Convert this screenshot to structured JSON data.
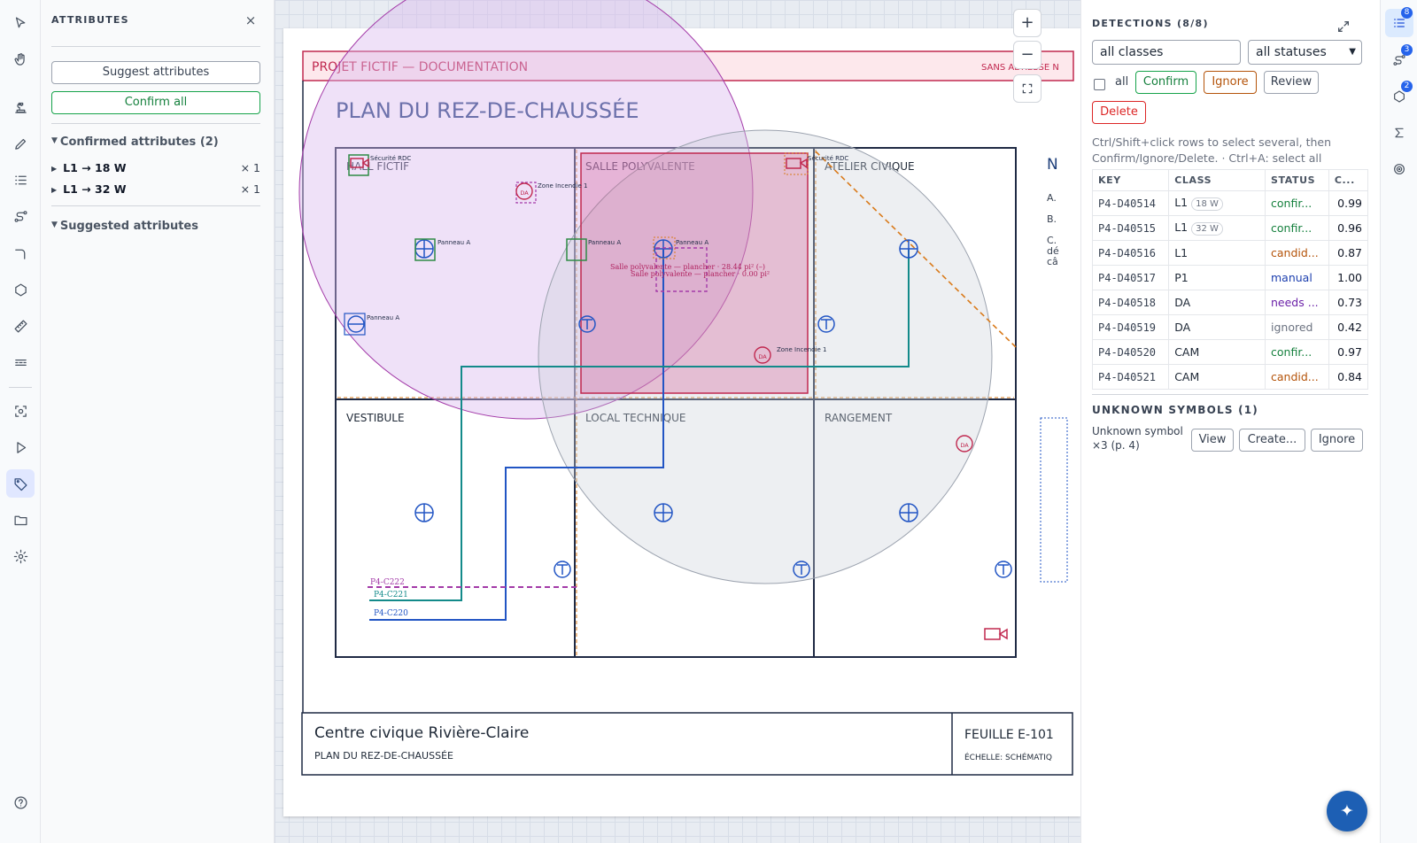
{
  "left_rail": {
    "icons": [
      "pointer-icon",
      "hand-icon",
      "stamp-icon",
      "pencil-icon",
      "list-icon",
      "path-icon",
      "bend-icon",
      "hexagon-icon",
      "ruler-icon",
      "dashes-icon",
      "scan-icon",
      "play-icon",
      "tag-icon",
      "folder-icon",
      "gear-icon",
      "help-icon"
    ],
    "active": "tag-icon"
  },
  "attributes": {
    "title": "ATTRIBUTES",
    "close": "×",
    "suggest_label": "Suggest attributes",
    "confirm_all_label": "Confirm all",
    "confirmed_heading": "Confirmed attributes (2)",
    "confirmed": [
      {
        "label": "L1 → 18 W",
        "count": "× 1"
      },
      {
        "label": "L1 → 32 W",
        "count": "× 1"
      }
    ],
    "suggested_heading": "Suggested attributes"
  },
  "zoom": {
    "in": "+",
    "out": "−"
  },
  "plan": {
    "header": "PROJET FICTIF — DOCUMENTATION",
    "header_right": "SANS ADRESSE N",
    "title": "PLAN DU REZ-DE-CHAUSSÉE",
    "right_note_letter": "N",
    "right_notes": [
      "A.",
      "B.",
      "C.",
      "dé",
      "câ"
    ],
    "rooms": [
      "HALL FICTIF",
      "SALLE POLYVALENTE",
      "ATELIER CIVIQUE",
      "VESTIBULE",
      "LOCAL TECHNIQUE",
      "RANGEMENT"
    ],
    "labels": {
      "securite1": "Sécurité RDC",
      "securite2": "Sécurité RDC",
      "zone1": "Zone Incendie 1",
      "zone2": "Zone Incendie 1",
      "panneau1": "Panneau A",
      "panneau2": "Panneau A",
      "panneau3": "Panneau A",
      "panneau4": "Panneau A",
      "da": "DA",
      "floor1": "Salle polyvalente — plancher · 28.44 pi² (–)",
      "floor2": "Salle polyvalente — plancher · 0.00 pi²"
    },
    "circuits": [
      "P4-C222",
      "P4-C221",
      "P4-C220"
    ],
    "title_block": {
      "project": "Centre civique Rivière-Claire",
      "subtitle": "PLAN DU REZ-DE-CHAUSSÉE",
      "sheet": "FEUILLE E-101",
      "scale": "ÉCHELLE: SCHÉMATIQ"
    },
    "colors": {
      "accent": "#c0284f",
      "blue": "#2255c4",
      "teal": "#138a8a",
      "purple": "#a33aa8",
      "orange": "#d97a1a",
      "green": "#2e8b45"
    }
  },
  "detections": {
    "title": "DETECTIONS (8/8)",
    "class_filter": "all classes",
    "status_filter": "all statuses",
    "all_label": "all",
    "confirm": "Confirm",
    "ignore": "Ignore",
    "review": "Review",
    "delete": "Delete",
    "hint": "Ctrl/Shift+click rows to select several, then Confirm/Ignore/Delete. · Ctrl+A: select all",
    "columns": [
      "KEY",
      "CLASS",
      "STATUS",
      "C..."
    ],
    "rows": [
      {
        "key": "P4-D40514",
        "class": "L1",
        "attr": "18 W",
        "status": "confir...",
        "conf": "0.99",
        "color": "#15803d"
      },
      {
        "key": "P4-D40515",
        "class": "L1",
        "attr": "32 W",
        "status": "confir...",
        "conf": "0.96",
        "color": "#15803d"
      },
      {
        "key": "P4-D40516",
        "class": "L1",
        "attr": "",
        "status": "candid...",
        "conf": "0.87",
        "color": "#b45309"
      },
      {
        "key": "P4-D40517",
        "class": "P1",
        "attr": "",
        "status": "manual",
        "conf": "1.00",
        "color": "#1e40af"
      },
      {
        "key": "P4-D40518",
        "class": "DA",
        "attr": "",
        "status": "needs ...",
        "conf": "0.73",
        "color": "#6b21a8"
      },
      {
        "key": "P4-D40519",
        "class": "DA",
        "attr": "",
        "status": "ignored",
        "conf": "0.42",
        "color": "#6b7280"
      },
      {
        "key": "P4-D40520",
        "class": "CAM",
        "attr": "",
        "status": "confir...",
        "conf": "0.97",
        "color": "#15803d"
      },
      {
        "key": "P4-D40521",
        "class": "CAM",
        "attr": "",
        "status": "candid...",
        "conf": "0.84",
        "color": "#b45309"
      }
    ]
  },
  "unknown": {
    "title": "UNKNOWN SYMBOLS (1)",
    "text": "Unknown symbol ×3 (p. 4)",
    "view": "View",
    "create": "Create...",
    "ignore": "Ignore"
  },
  "right_rail": {
    "badges": [
      "8",
      "3",
      "2"
    ]
  },
  "fab": "✦"
}
